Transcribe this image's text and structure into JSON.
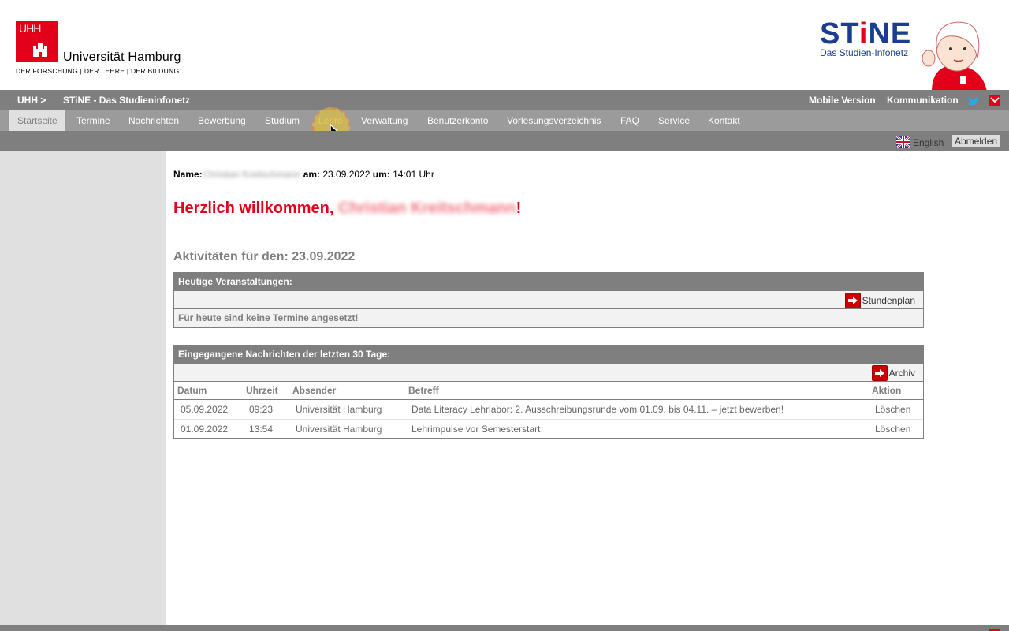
{
  "header": {
    "uhh_logo_text": "UHH",
    "university_name": "Universität Hamburg",
    "motto": "DER FORSCHUNG | DER LEHRE | DER BILDUNG",
    "stine_logo_pre": "ST",
    "stine_logo_i": "i",
    "stine_logo_post": "NE",
    "stine_subtitle": "Das Studien-Infonetz"
  },
  "topbar": {
    "breadcrumb_uhh": "UHH >",
    "breadcrumb_stine": "STiNE - Das Studieninfonetz",
    "mobile_version": "Mobile Version",
    "kommunikation": "Kommunikation"
  },
  "nav": {
    "items": [
      "Startseite",
      "Termine",
      "Nachrichten",
      "Bewerbung",
      "Studium",
      "Lehre",
      "Verwaltung",
      "Benutzerkonto",
      "Vorlesungsverzeichnis",
      "FAQ",
      "Service",
      "Kontakt"
    ],
    "active": "Startseite",
    "hovered": "Lehre"
  },
  "subbar": {
    "english": "English",
    "logout": "Abmelden"
  },
  "main": {
    "name_label": "Name:",
    "name_value": "Christian Kreitschmann",
    "date_label": "am:",
    "date_value": "23.09.2022",
    "time_label": "um:",
    "time_value": "14:01 Uhr",
    "welcome_prefix": "Herzlich willkommen,",
    "welcome_name": "Christian Kreitschmann",
    "welcome_suffix": "!",
    "activities_title": "Aktivitäten für den: 23.09.2022",
    "today": {
      "title": "Heutige Veranstaltungen:",
      "link": "Stundenplan",
      "empty_text": "Für heute sind keine Termine angesetzt!"
    },
    "messages": {
      "title": "Eingegangene Nachrichten der letzten 30 Tage:",
      "link": "Archiv",
      "columns": [
        "Datum",
        "Uhrzeit",
        "Absender",
        "Betreff",
        "Aktion"
      ],
      "rows": [
        [
          "05.09.2022",
          "09:23",
          "Universität Hamburg",
          "Data Literacy Lehrlabor: 2. Ausschreibungsrunde vom 01.09. bis 04.11. – jetzt bewerben!",
          "Löschen"
        ],
        [
          "01.09.2022",
          "13:54",
          "Universität Hamburg",
          "Lehrimpulse vor Semesterstart",
          "Löschen"
        ]
      ]
    }
  },
  "colors": {
    "uhh_red": "#e2001a",
    "bar_gray": "#7f7f7f",
    "nav_gray": "#9b9b9b",
    "stine_blue": "#1a3d8f"
  }
}
